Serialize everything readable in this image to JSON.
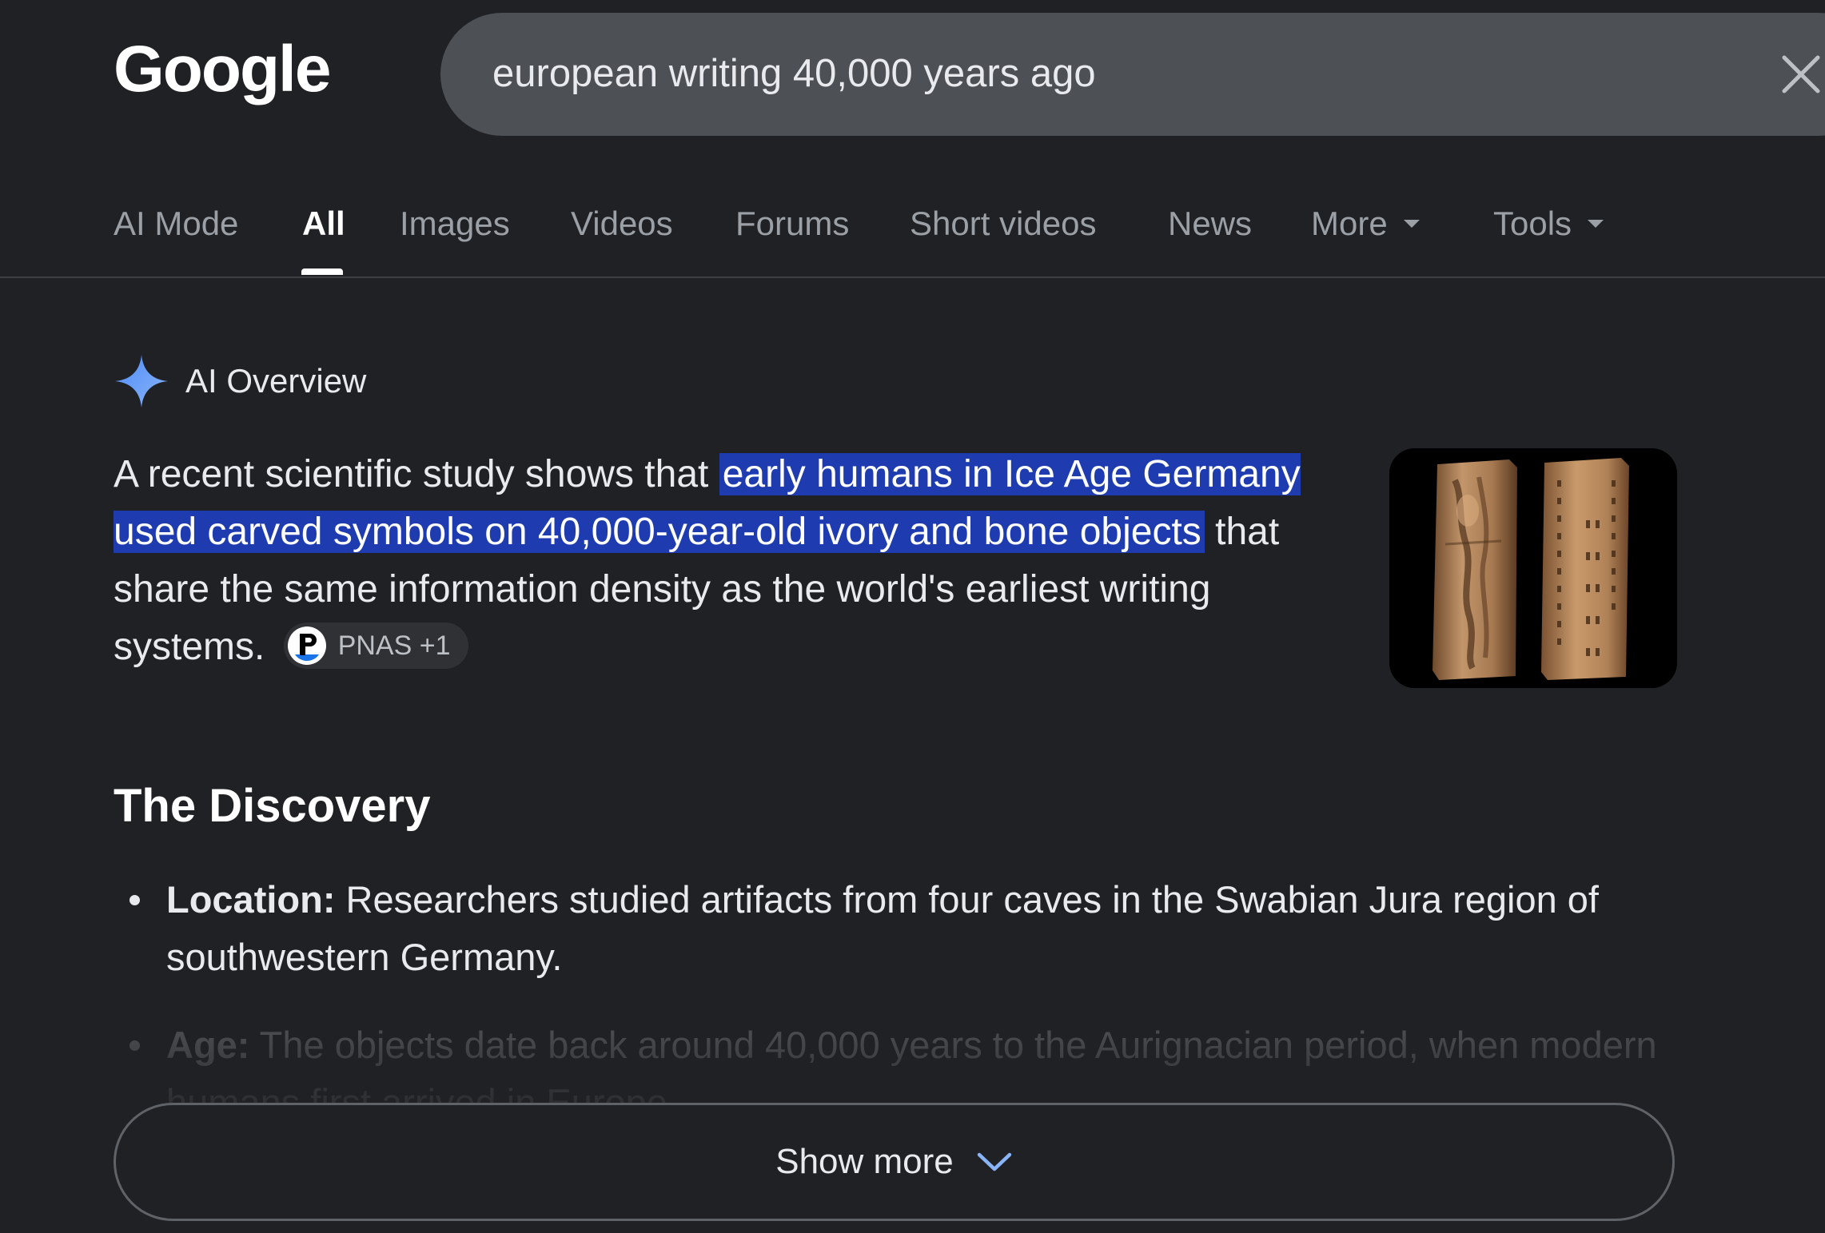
{
  "header": {
    "logo": "Google",
    "search": {
      "value": "european writing 40,000 years ago",
      "placeholder": ""
    }
  },
  "tabs": {
    "items": [
      {
        "label": "AI Mode"
      },
      {
        "label": "All"
      },
      {
        "label": "Images"
      },
      {
        "label": "Videos"
      },
      {
        "label": "Forums"
      },
      {
        "label": "Short videos"
      },
      {
        "label": "News"
      },
      {
        "label": "More"
      },
      {
        "label": "Tools"
      }
    ],
    "active": "All"
  },
  "ai_overview": {
    "title": "AI Overview",
    "text_before": "A recent scientific study shows that ",
    "text_highlight": "early humans in Ice Age Germany used carved symbols on 40,000-year-old ivory and bone objects",
    "text_after": " that share the same information density as the world's earliest writing systems.",
    "source_chip": "PNAS +1"
  },
  "discovery": {
    "title": "The Discovery",
    "bullets": [
      {
        "label": "Location:",
        "text": " Researchers studied artifacts from four caves in the Swabian Jura region of southwestern Germany."
      },
      {
        "label": "Age:",
        "text": " The objects date back around 40,000 years to the Aurignacian period, when modern humans first arrived in Europe."
      }
    ]
  },
  "show_more": {
    "label": "Show more"
  },
  "colors": {
    "background": "#202124",
    "search_bg": "#4d5156",
    "highlight": "#1e3caf",
    "sparkle": "#4f8df7"
  }
}
